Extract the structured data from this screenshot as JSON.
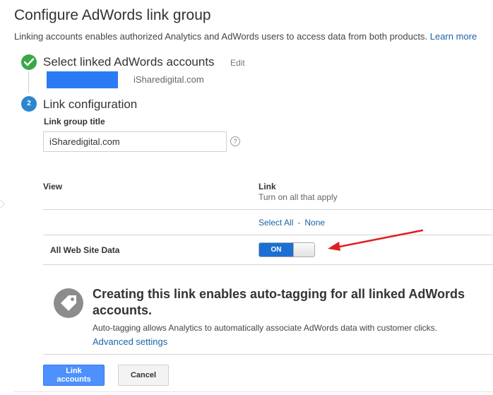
{
  "page": {
    "title": "Configure AdWords link group",
    "description": "Linking accounts enables authorized Analytics and AdWords users to access data from both products.",
    "learn_more": "Learn more"
  },
  "step1": {
    "label": "Select linked AdWords accounts",
    "edit_label": "Edit",
    "account_name": "iSharedigital.com"
  },
  "step2": {
    "number": "2",
    "label": "Link configuration",
    "link_group_title_label": "Link group title",
    "link_group_title_value": "iSharedigital.com",
    "help_icon": "?"
  },
  "table": {
    "col_view": "View",
    "col_link": "Link",
    "col_link_sub": "Turn on all that apply",
    "select_all": "Select All",
    "separator": "-",
    "none": "None",
    "rows": [
      {
        "view": "All Web Site Data",
        "toggle_label": "ON",
        "on": true
      }
    ]
  },
  "autotag": {
    "heading": "Creating this link enables auto-tagging for all linked AdWords accounts.",
    "body": "Auto-tagging allows Analytics to automatically associate AdWords data with customer clicks.",
    "advanced_settings": "Advanced settings"
  },
  "buttons": {
    "link_accounts": "Link accounts",
    "cancel": "Cancel"
  },
  "colors": {
    "accent": "#1a63a8",
    "success": "#3aa847",
    "step_blue": "#2a87cf",
    "toggle_on": "#1b6fd2",
    "primary_button": "#4d90fe",
    "arrow_annotation": "#e02020",
    "redaction": "#2b7bf5"
  },
  "icons": {
    "step1": "check-circle-icon",
    "help": "help-circle-icon",
    "autotag": "tag-icon",
    "annotation": "red-arrow-icon"
  }
}
